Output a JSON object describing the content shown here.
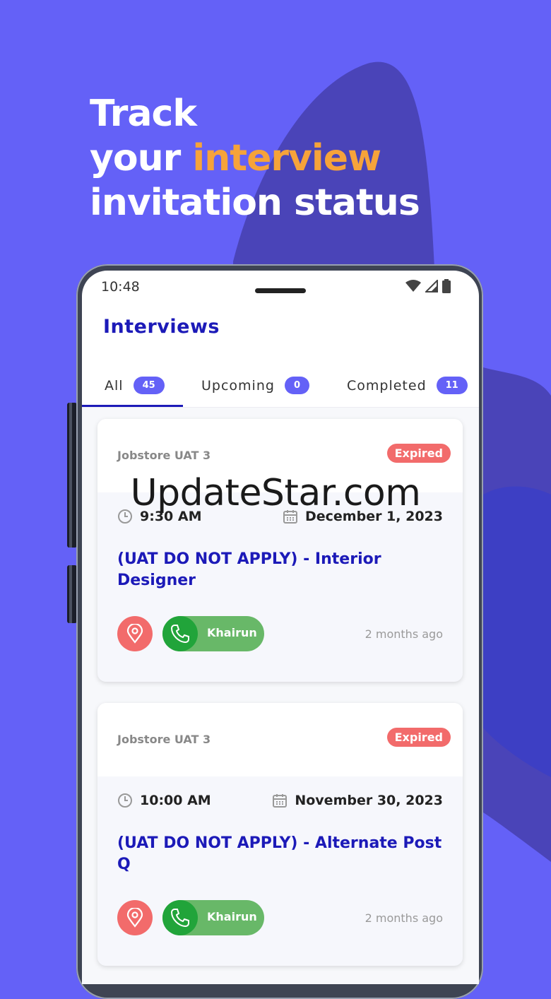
{
  "headline": {
    "line1": "Track",
    "line2_prefix": "your ",
    "line2_accent": "interview",
    "line3": "invitation status"
  },
  "colors": {
    "background": "#6461f7",
    "accent": "#f6a33a",
    "primary_blue": "#1c1ab8",
    "expired_red": "#f26b6b",
    "call_green": "#21a43a"
  },
  "status_bar": {
    "time": "10:48",
    "icons": [
      "wifi-icon",
      "signal-icon",
      "battery-icon"
    ]
  },
  "app": {
    "title": "Interviews"
  },
  "tabs": [
    {
      "label": "All",
      "count": "45"
    },
    {
      "label": "Upcoming",
      "count": "0"
    },
    {
      "label": "Completed",
      "count": "11"
    }
  ],
  "interviews": [
    {
      "company": "Jobstore UAT 3",
      "status": "Expired",
      "time": "9:30 AM",
      "date": "December 1, 2023",
      "title": "(UAT DO NOT APPLY) - Interior Designer",
      "contact": "Khairun",
      "ago": "2 months ago"
    },
    {
      "company": "Jobstore UAT 3",
      "status": "Expired",
      "time": "10:00 AM",
      "date": "November 30, 2023",
      "title": "(UAT DO NOT APPLY) - Alternate Post Q",
      "contact": "Khairun",
      "ago": "2 months ago"
    }
  ],
  "watermark": "UpdateStar.com"
}
